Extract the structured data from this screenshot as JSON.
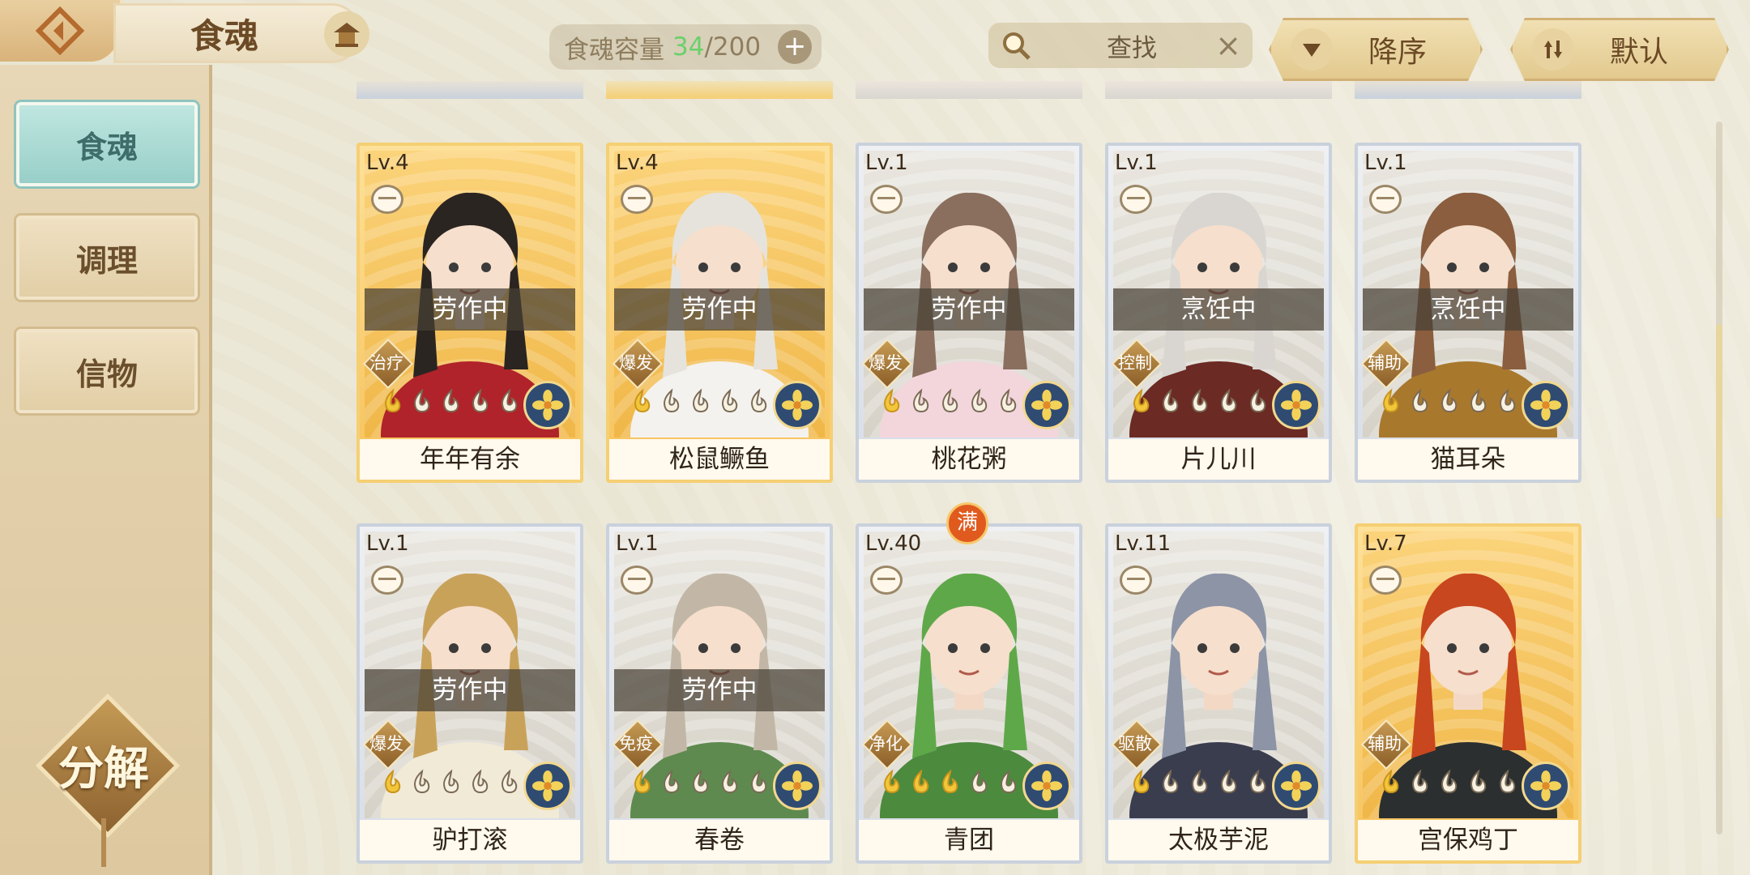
{
  "topbar": {
    "title": "食魂",
    "capacity_label": "食魂容量",
    "capacity_current": "34",
    "capacity_slash": "/",
    "capacity_max": "200",
    "capacity_plus": "+",
    "search_text": "查找",
    "search_clear": "×",
    "sort_order_label": "降序",
    "sort_mode_label": "默认"
  },
  "sidebar": {
    "tabs": [
      {
        "label": "食魂",
        "active": true
      },
      {
        "label": "调理",
        "active": false
      },
      {
        "label": "信物",
        "active": false
      }
    ],
    "decompose_label": "分解"
  },
  "cards": [
    {
      "level": "Lv.4",
      "status": "劳作中",
      "role": "治疗",
      "name": "年年有余",
      "tier": "gold",
      "flames_lit": 1
    },
    {
      "level": "Lv.4",
      "status": "劳作中",
      "role": "爆发",
      "name": "松鼠鳜鱼",
      "tier": "gold",
      "flames_lit": 1
    },
    {
      "level": "Lv.1",
      "status": "劳作中",
      "role": "爆发",
      "name": "桃花粥",
      "tier": "silver",
      "flames_lit": 1
    },
    {
      "level": "Lv.1",
      "status": "烹饪中",
      "role": "控制",
      "name": "片儿川",
      "tier": "silver",
      "flames_lit": 1
    },
    {
      "level": "Lv.1",
      "status": "烹饪中",
      "role": "辅助",
      "name": "猫耳朵",
      "tier": "silver",
      "flames_lit": 1
    },
    {
      "level": "Lv.1",
      "status": "劳作中",
      "role": "爆发",
      "name": "驴打滚",
      "tier": "silver",
      "flames_lit": 1
    },
    {
      "level": "Lv.1",
      "status": "劳作中",
      "role": "免疫",
      "name": "春卷",
      "tier": "silver",
      "flames_lit": 1
    },
    {
      "level": "Lv.40",
      "status": "",
      "role": "净化",
      "name": "青团",
      "tier": "silver",
      "flames_lit": 3,
      "full_badge": "满"
    },
    {
      "level": "Lv.11",
      "status": "",
      "role": "驱散",
      "name": "太极芋泥",
      "tier": "silver",
      "flames_lit": 1
    },
    {
      "level": "Lv.7",
      "status": "",
      "role": "辅助",
      "name": "宫保鸡丁",
      "tier": "gold",
      "flames_lit": 1
    }
  ],
  "colors": {
    "accent_gold": "#f5cf73",
    "capacity_current": "#6bd06b",
    "tab_active": "#98cfc8"
  },
  "icons": [
    "back-arrow-icon",
    "house-icon",
    "search-icon",
    "close-icon",
    "triangle-down-icon",
    "sort-arrows-icon",
    "bowl-icon",
    "flame-icon",
    "flower-element-icon"
  ]
}
